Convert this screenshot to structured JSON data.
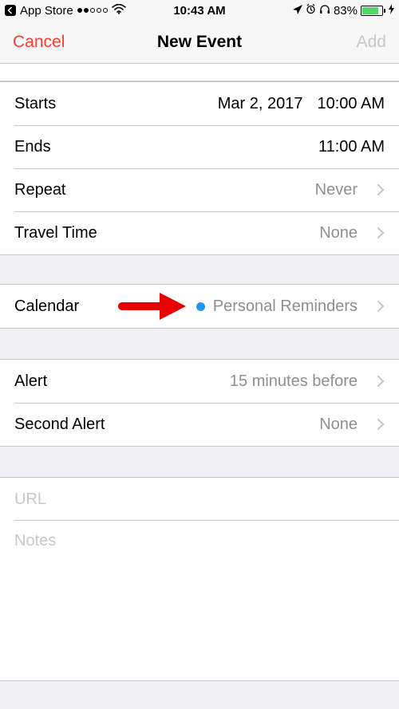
{
  "status": {
    "back_label": "App Store",
    "time": "10:43 AM",
    "battery_pct": "83%"
  },
  "nav": {
    "cancel": "Cancel",
    "title": "New Event",
    "add": "Add"
  },
  "rows": {
    "starts": {
      "label": "Starts",
      "date": "Mar 2, 2017",
      "time": "10:00 AM"
    },
    "ends": {
      "label": "Ends",
      "time": "11:00 AM"
    },
    "repeat": {
      "label": "Repeat",
      "value": "Never"
    },
    "travel": {
      "label": "Travel Time",
      "value": "None"
    },
    "calendar": {
      "label": "Calendar",
      "value": "Personal Reminders"
    },
    "alert": {
      "label": "Alert",
      "value": "15 minutes before"
    },
    "second_alert": {
      "label": "Second Alert",
      "value": "None"
    },
    "url": {
      "placeholder": "URL"
    },
    "notes": {
      "placeholder": "Notes"
    }
  },
  "colors": {
    "calendar_dot": "#2196f3",
    "cancel": "#ff3b30",
    "arrow": "#e60000"
  }
}
